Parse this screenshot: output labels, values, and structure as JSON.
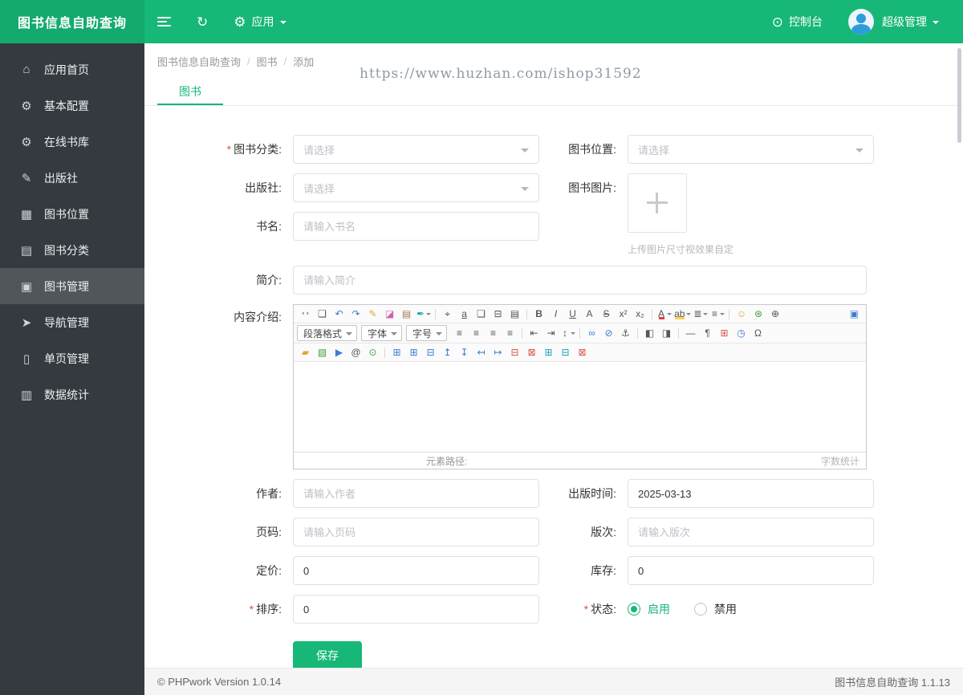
{
  "colors": {
    "accent": "#16b777",
    "sidebar_bg": "#343a3f",
    "footer_bg": "#f5f5f5"
  },
  "app": {
    "title": "图书信息自助查询",
    "footer_left": "© PHPwork Version 1.0.14",
    "footer_right": "图书信息自助查询 1.1.13"
  },
  "header": {
    "app_menu_label": "应用",
    "console_label": "控制台",
    "admin_label": "超级管理"
  },
  "sidebar": {
    "items": [
      {
        "name": "sidebar-item-home",
        "icon": "home-icon",
        "label": "应用首页"
      },
      {
        "name": "sidebar-item-basic-config",
        "icon": "gear-icon",
        "label": "基本配置"
      },
      {
        "name": "sidebar-item-online-library",
        "icon": "gear-icon",
        "label": "在线书库"
      },
      {
        "name": "sidebar-item-publisher",
        "icon": "edit-icon",
        "label": "出版社"
      },
      {
        "name": "sidebar-item-book-location",
        "icon": "grid-icon",
        "label": "图书位置"
      },
      {
        "name": "sidebar-item-book-category",
        "icon": "category-icon",
        "label": "图书分类"
      },
      {
        "name": "sidebar-item-book-management",
        "icon": "book-icon",
        "label": "图书管理",
        "active": true
      },
      {
        "name": "sidebar-item-nav-management",
        "icon": "send-icon",
        "label": "导航管理"
      },
      {
        "name": "sidebar-item-page-management",
        "icon": "page-icon",
        "label": "单页管理"
      },
      {
        "name": "sidebar-item-statistics",
        "icon": "chart-icon",
        "label": "数据统计"
      }
    ]
  },
  "breadcrumb": {
    "separator": "/",
    "items": [
      "图书信息自助查询",
      "图书",
      "添加"
    ]
  },
  "watermark": "https://www.huzhan.com/ishop31592",
  "tab": {
    "label": "图书"
  },
  "form": {
    "required_mark": "*",
    "category_label": "图书分类:",
    "category_value": "请选择",
    "location_label": "图书位置:",
    "location_value": "请选择",
    "publisher_label": "出版社:",
    "publisher_value": "请选择",
    "image_label": "图书图片:",
    "image_hint": "上传图片尺寸视效果自定",
    "book_name_label": "书名:",
    "book_name_placeholder": "请输入书名",
    "intro_label": "简介:",
    "intro_placeholder": "请输入简介",
    "content_label": "内容介绍:",
    "author_label": "作者:",
    "author_placeholder": "请输入作者",
    "pub_date_label": "出版时间:",
    "pub_date_value": "2025-03-13",
    "pages_label": "页码:",
    "pages_placeholder": "请输入页码",
    "edition_label": "版次:",
    "edition_placeholder": "请输入版次",
    "price_label": "定价:",
    "price_value": "0",
    "stock_label": "库存:",
    "stock_value": "0",
    "sort_label": "排序:",
    "sort_value": "0",
    "status_label": "状态:",
    "status_options": [
      {
        "name": "status-radio-enabled",
        "label": "启用",
        "active": true
      },
      {
        "name": "status-radio-disabled",
        "label": "禁用"
      }
    ],
    "save_label": "保存"
  },
  "editor": {
    "selects": [
      "段落格式",
      "字体",
      "字号"
    ],
    "toolbar_row1": [
      "html-source-icon",
      "preview-icon",
      "undo-icon",
      "redo-icon",
      "pencil-icon",
      "eraser-icon",
      "paste-icon",
      "format-brush-icon",
      "separator",
      "find-icon",
      "replace-icon",
      "page2-icon",
      "print-icon",
      "template-icon",
      "separator",
      "bold-icon",
      "italic-icon",
      "underline-icon",
      "remove-format-icon",
      "strikethrough-icon",
      "superscript-icon",
      "subscript-icon",
      "separator",
      "text-color-icon",
      "highlight-color-icon",
      "ordered-list-icon",
      "unordered-list-icon",
      "separator",
      "emoji-icon",
      "media-icon",
      "zoom-icon",
      "fullscreen-icon"
    ],
    "toolbar_row2": [
      "align-left-icon",
      "align-center-icon",
      "align-right-icon",
      "align-justify-icon",
      "separator",
      "outdent-icon",
      "indent-icon",
      "line-height-icon",
      "separator",
      "link-icon",
      "unlink-icon",
      "anchor-icon",
      "separator",
      "image-left-icon",
      "image-right-icon",
      "separator",
      "hr-icon",
      "paragraph-icon",
      "calendar-icon",
      "clock-icon",
      "omega-icon"
    ],
    "toolbar_row3": [
      "flash-icon",
      "image-icon",
      "video-icon",
      "attach-icon",
      "map-icon",
      "separator",
      "table-icon",
      "table-prop-icon",
      "cell-prop-icon",
      "insert-row-above-icon",
      "insert-row-below-icon",
      "insert-col-left-icon",
      "insert-col-right-icon",
      "delete-row-icon",
      "delete-col-icon",
      "merge-cells-icon",
      "split-cells-icon",
      "delete-table-icon"
    ],
    "status_left": "元素路径:",
    "status_right": "字数统计"
  }
}
